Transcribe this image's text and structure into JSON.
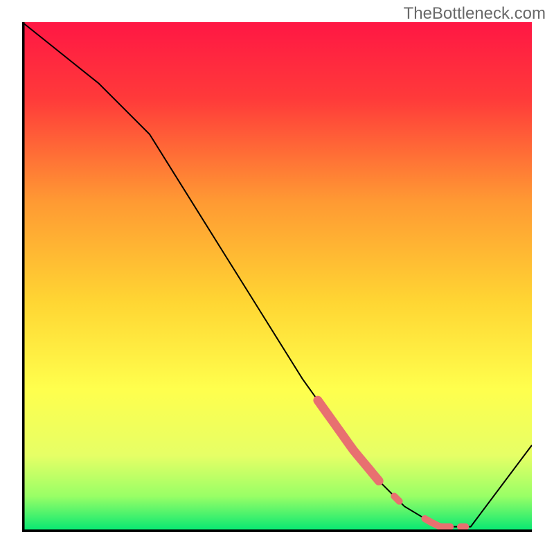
{
  "watermark": "TheBottleneck.com",
  "chart_data": {
    "type": "line",
    "title": "",
    "xlabel": "",
    "ylabel": "",
    "xlim": [
      0,
      100
    ],
    "ylim": [
      0,
      100
    ],
    "x": [
      0,
      5,
      10,
      15,
      20,
      25,
      30,
      35,
      40,
      45,
      50,
      55,
      60,
      65,
      70,
      75,
      80,
      82,
      85,
      88,
      100
    ],
    "values": [
      100,
      96,
      92,
      88,
      83,
      78,
      70,
      62,
      54,
      46,
      38,
      30,
      23,
      16,
      10,
      5,
      2,
      1,
      1,
      1,
      17
    ],
    "highlight_segments": [
      {
        "x_start": 58,
        "x_end": 70,
        "thickness": "thick"
      },
      {
        "x_start": 73,
        "x_end": 74,
        "thickness": "dot"
      },
      {
        "x_start": 79,
        "x_end": 84,
        "thickness": "medium"
      },
      {
        "x_start": 86,
        "x_end": 87,
        "thickness": "dot"
      }
    ],
    "background": {
      "type": "vertical-gradient",
      "stops": [
        {
          "pos": 0.0,
          "color": "#ff1744"
        },
        {
          "pos": 0.15,
          "color": "#ff3a3a"
        },
        {
          "pos": 0.35,
          "color": "#ff9933"
        },
        {
          "pos": 0.55,
          "color": "#ffd633"
        },
        {
          "pos": 0.72,
          "color": "#ffff4d"
        },
        {
          "pos": 0.85,
          "color": "#e6ff66"
        },
        {
          "pos": 0.93,
          "color": "#99ff66"
        },
        {
          "pos": 1.0,
          "color": "#00e673"
        }
      ]
    },
    "axis_color": "#000000",
    "line_color": "#000000",
    "highlight_color": "#e87070"
  }
}
